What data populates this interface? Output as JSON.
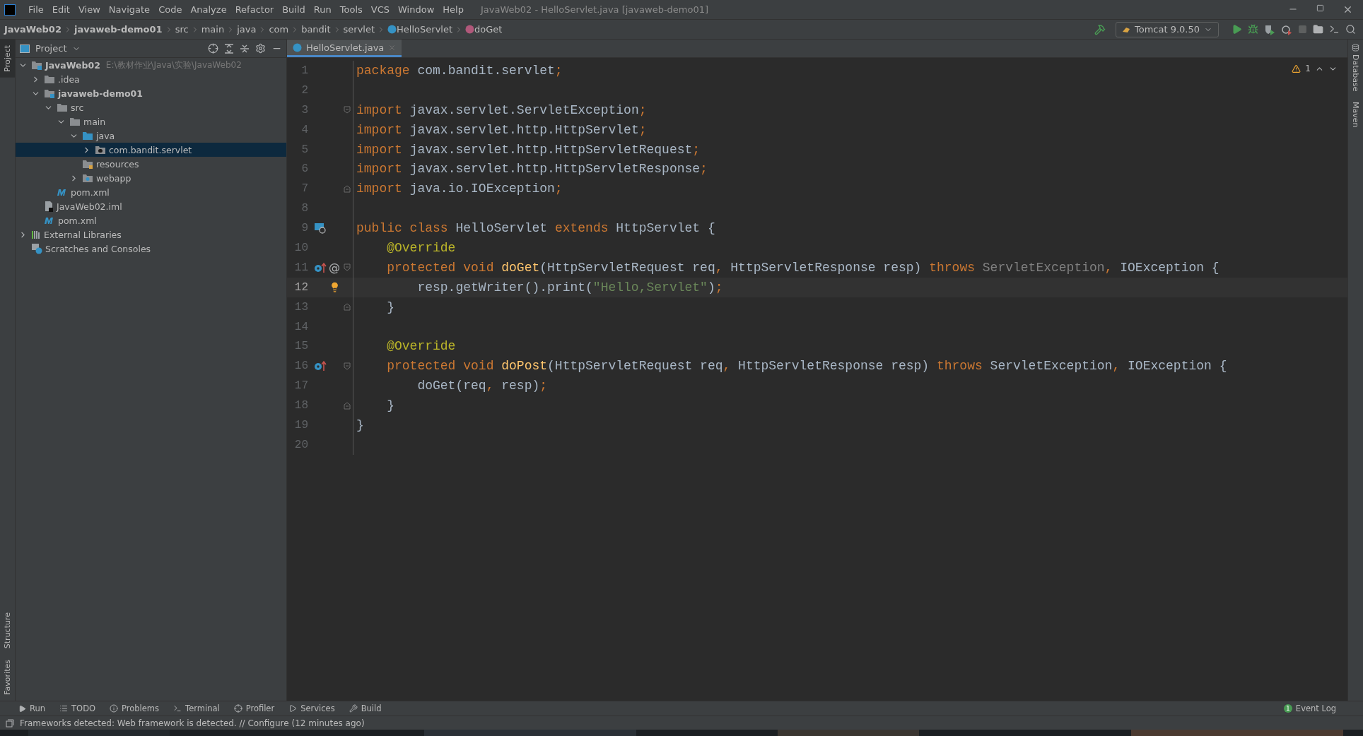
{
  "window": {
    "title": "JavaWeb02 - HelloServlet.java [javaweb-demo01]"
  },
  "menu": [
    "File",
    "Edit",
    "View",
    "Navigate",
    "Code",
    "Analyze",
    "Refactor",
    "Build",
    "Run",
    "Tools",
    "VCS",
    "Window",
    "Help"
  ],
  "breadcrumbs": [
    {
      "label": "JavaWeb02",
      "kind": "bold"
    },
    {
      "label": "javaweb-demo01",
      "kind": "bold"
    },
    {
      "label": "src",
      "kind": "plain"
    },
    {
      "label": "main",
      "kind": "plain"
    },
    {
      "label": "java",
      "kind": "plain"
    },
    {
      "label": "com",
      "kind": "plain"
    },
    {
      "label": "bandit",
      "kind": "plain"
    },
    {
      "label": "servlet",
      "kind": "plain"
    },
    {
      "label": "HelloServlet",
      "kind": "class"
    },
    {
      "label": "doGet",
      "kind": "method"
    }
  ],
  "run_config": "Tomcat 9.0.50",
  "left_strip": [
    {
      "label": "Project",
      "selected": true
    },
    {
      "label": "Structure",
      "selected": false
    },
    {
      "label": "Favorites",
      "selected": false
    }
  ],
  "right_strip": [
    "Database",
    "Maven"
  ],
  "project_panel": {
    "title": "Project",
    "tree": [
      {
        "label": "JavaWeb02",
        "hint": "E:\\教材作业\\Java\\实验\\JavaWeb02",
        "kind": "module",
        "expanded": true,
        "selected": false,
        "children": [
          {
            "label": ".idea",
            "kind": "folder",
            "expanded": false,
            "selected": false
          },
          {
            "label": "javaweb-demo01",
            "kind": "module",
            "expanded": true,
            "selected": false,
            "children": [
              {
                "label": "src",
                "kind": "folder",
                "expanded": true,
                "selected": false,
                "children": [
                  {
                    "label": "main",
                    "kind": "folder",
                    "expanded": true,
                    "selected": false,
                    "children": [
                      {
                        "label": "java",
                        "kind": "source",
                        "expanded": true,
                        "selected": false,
                        "children": [
                          {
                            "label": "com.bandit.servlet",
                            "kind": "package",
                            "expanded": false,
                            "selected": true
                          }
                        ]
                      },
                      {
                        "label": "resources",
                        "kind": "resources",
                        "selected": false
                      },
                      {
                        "label": "webapp",
                        "kind": "webapp",
                        "expanded": false,
                        "selected": false
                      }
                    ]
                  }
                ]
              },
              {
                "label": "pom.xml",
                "kind": "maven",
                "selected": false
              }
            ]
          },
          {
            "label": "JavaWeb02.iml",
            "kind": "iml",
            "selected": false
          },
          {
            "label": "pom.xml",
            "kind": "maven",
            "selected": false
          }
        ]
      },
      {
        "label": "External Libraries",
        "kind": "libraries",
        "expanded": false,
        "selected": false
      },
      {
        "label": "Scratches and Consoles",
        "kind": "scratches",
        "selected": false
      }
    ]
  },
  "editor": {
    "tabs": [
      {
        "label": "HelloServlet.java",
        "selected": true
      }
    ],
    "warnings": "1",
    "lines": [
      {
        "number": "1",
        "current": false,
        "tokens": [
          {
            "text": "package ",
            "kind": "keyword"
          },
          {
            "text": "com.bandit.servlet",
            "kind": "plain"
          },
          {
            "text": ";",
            "kind": "keyword"
          }
        ]
      },
      {
        "number": "2",
        "current": false
      },
      {
        "number": "3",
        "current": false,
        "fold_start": true,
        "tokens": [
          {
            "text": "import ",
            "kind": "keyword"
          },
          {
            "text": "javax.servlet.ServletException",
            "kind": "plain"
          },
          {
            "text": ";",
            "kind": "keyword"
          }
        ]
      },
      {
        "number": "4",
        "current": false,
        "tokens": [
          {
            "text": "import ",
            "kind": "keyword"
          },
          {
            "text": "javax.servlet.http.HttpServlet",
            "kind": "plain"
          },
          {
            "text": ";",
            "kind": "keyword"
          }
        ]
      },
      {
        "number": "5",
        "current": false,
        "tokens": [
          {
            "text": "import ",
            "kind": "keyword"
          },
          {
            "text": "javax.servlet.http.HttpServletRequest",
            "kind": "plain"
          },
          {
            "text": ";",
            "kind": "keyword"
          }
        ]
      },
      {
        "number": "6",
        "current": false,
        "tokens": [
          {
            "text": "import ",
            "kind": "keyword"
          },
          {
            "text": "javax.servlet.http.HttpServletResponse",
            "kind": "plain"
          },
          {
            "text": ";",
            "kind": "keyword"
          }
        ]
      },
      {
        "number": "7",
        "current": false,
        "fold_end": true,
        "tokens": [
          {
            "text": "import ",
            "kind": "keyword"
          },
          {
            "text": "java.io.IOException",
            "kind": "plain"
          },
          {
            "text": ";",
            "kind": "keyword"
          }
        ]
      },
      {
        "number": "8",
        "current": false
      },
      {
        "number": "9",
        "current": false,
        "markers": [
          {
            "kind": "servlet"
          }
        ],
        "tokens": [
          {
            "text": "public class ",
            "kind": "keyword"
          },
          {
            "text": "HelloServlet ",
            "kind": "plain"
          },
          {
            "text": "extends ",
            "kind": "keyword"
          },
          {
            "text": "HttpServlet {",
            "kind": "plain"
          }
        ]
      },
      {
        "number": "10",
        "current": false,
        "tokens": [
          {
            "text": "    @Override",
            "kind": "annotation"
          }
        ]
      },
      {
        "number": "11",
        "current": false,
        "markers": [
          {
            "kind": "override"
          },
          {
            "kind": "symbol",
            "text": "@"
          }
        ],
        "fold_start": true,
        "tokens": [
          {
            "text": "    protected void ",
            "kind": "keyword"
          },
          {
            "text": "doGet",
            "kind": "method"
          },
          {
            "text": "(HttpServletRequest req",
            "kind": "plain"
          },
          {
            "text": ", ",
            "kind": "keyword"
          },
          {
            "text": "HttpServletResponse resp) ",
            "kind": "plain"
          },
          {
            "text": "throws ",
            "kind": "keyword"
          },
          {
            "text": "ServletException",
            "kind": "unused"
          },
          {
            "text": ", ",
            "kind": "keyword"
          },
          {
            "text": "IOException {",
            "kind": "plain"
          }
        ]
      },
      {
        "number": "12",
        "current": true,
        "bulb": true,
        "tokens": [
          {
            "text": "        resp.getWriter().print(",
            "kind": "plain"
          },
          {
            "text": "\"Hello,Servlet\"",
            "kind": "string"
          },
          {
            "text": ")",
            "kind": "plain"
          },
          {
            "text": ";",
            "kind": "keyword"
          }
        ]
      },
      {
        "number": "13",
        "current": false,
        "fold_end": true,
        "tokens": [
          {
            "text": "    }",
            "kind": "plain"
          }
        ]
      },
      {
        "number": "14",
        "current": false
      },
      {
        "number": "15",
        "current": false,
        "tokens": [
          {
            "text": "    @Override",
            "kind": "annotation"
          }
        ]
      },
      {
        "number": "16",
        "current": false,
        "markers": [
          {
            "kind": "override"
          }
        ],
        "fold_start": true,
        "tokens": [
          {
            "text": "    protected void ",
            "kind": "keyword"
          },
          {
            "text": "doPost",
            "kind": "method"
          },
          {
            "text": "(HttpServletRequest req",
            "kind": "plain"
          },
          {
            "text": ", ",
            "kind": "keyword"
          },
          {
            "text": "HttpServletResponse resp) ",
            "kind": "plain"
          },
          {
            "text": "throws ",
            "kind": "keyword"
          },
          {
            "text": "ServletException",
            "kind": "plain"
          },
          {
            "text": ", ",
            "kind": "keyword"
          },
          {
            "text": "IOException {",
            "kind": "plain"
          }
        ]
      },
      {
        "number": "17",
        "current": false,
        "tokens": [
          {
            "text": "        doGet(req",
            "kind": "plain"
          },
          {
            "text": ", ",
            "kind": "keyword"
          },
          {
            "text": "resp)",
            "kind": "plain"
          },
          {
            "text": ";",
            "kind": "keyword"
          }
        ]
      },
      {
        "number": "18",
        "current": false,
        "fold_end": true,
        "tokens": [
          {
            "text": "    }",
            "kind": "plain"
          }
        ]
      },
      {
        "number": "19",
        "current": false,
        "tokens": [
          {
            "text": "}",
            "kind": "plain"
          }
        ]
      },
      {
        "number": "20",
        "current": false
      }
    ]
  },
  "tool_buttons": [
    {
      "label": "Run",
      "kind": "run"
    },
    {
      "label": "TODO",
      "kind": "todo"
    },
    {
      "label": "Problems",
      "kind": "problems"
    },
    {
      "label": "Terminal",
      "kind": "terminal"
    },
    {
      "label": "Profiler",
      "kind": "profiler"
    },
    {
      "label": "Services",
      "kind": "services"
    },
    {
      "label": "Build",
      "kind": "build"
    }
  ],
  "event_log": {
    "label": "Event Log",
    "count": "1"
  },
  "status_bar": {
    "message": "Frameworks detected: Web framework is detected. // Configure (12 minutes ago)"
  }
}
